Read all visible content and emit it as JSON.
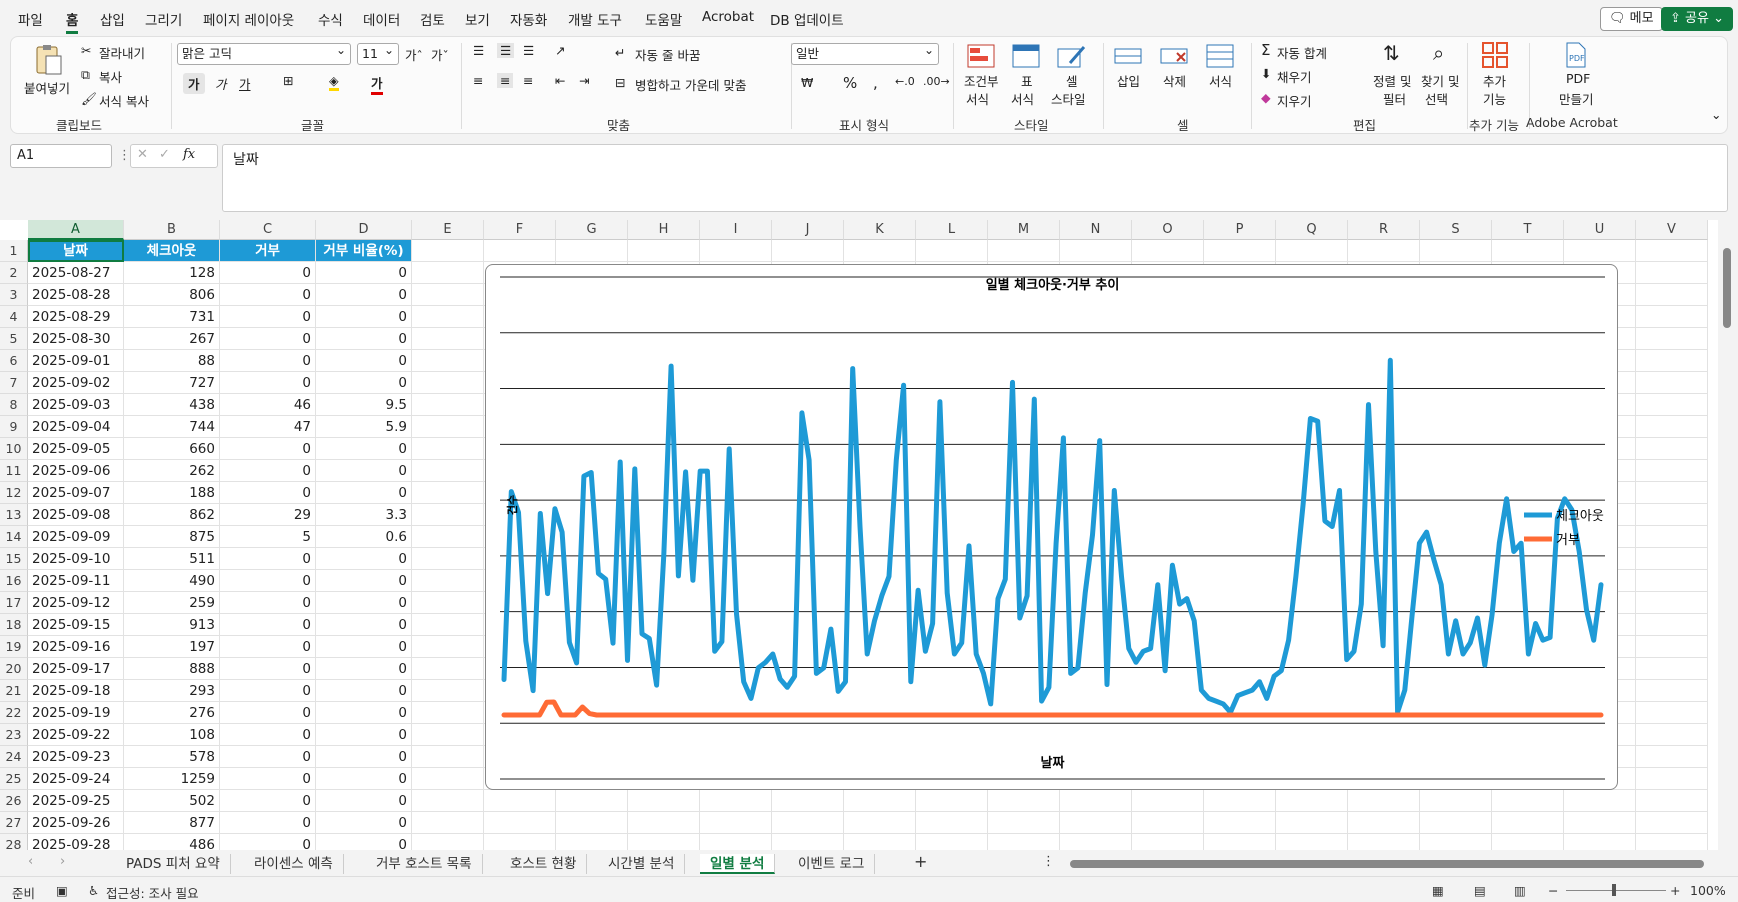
{
  "menubar": {
    "items": [
      "파일",
      "홈",
      "삽입",
      "그리기",
      "페이지 레이아웃",
      "수식",
      "데이터",
      "검토",
      "보기",
      "자동화",
      "개발 도구",
      "도움말",
      "Acrobat",
      "DB 업데이트"
    ],
    "active_index": 1,
    "memo_label": "메모",
    "share_label": "공유"
  },
  "ribbon": {
    "clipboard": {
      "paste": "붙여넣기",
      "cut": "잘라내기",
      "copy": "복사",
      "format_painter": "서식 복사",
      "label": "클립보드"
    },
    "font": {
      "name": "맑은 고딕",
      "size": "11",
      "bold": "가",
      "italic": "가",
      "underline": "가",
      "label": "글꼴"
    },
    "alignment": {
      "wrap": "자동 줄 바꿈",
      "merge": "병합하고 가운데 맞춤",
      "label": "맞춤"
    },
    "number": {
      "format": "일반",
      "label": "표시 형식"
    },
    "styles": {
      "conditional_1": "조건부",
      "conditional_2": "서식",
      "table_1": "표",
      "table_2": "서식",
      "cell_1": "셀",
      "cell_2": "스타일",
      "label": "스타일"
    },
    "cells": {
      "insert": "삽입",
      "delete": "삭제",
      "format": "서식",
      "label": "셀"
    },
    "editing": {
      "autosum": "자동 합계",
      "fill": "채우기",
      "clear": "지우기",
      "sort_1": "정렬 및",
      "sort_2": "필터",
      "find_1": "찾기 및",
      "find_2": "선택",
      "label": "편집"
    },
    "addins": {
      "btn_1": "추가",
      "btn_2": "기능",
      "label": "추가 기능"
    },
    "acrobat": {
      "btn_1": "PDF",
      "btn_2": "만들기",
      "label": "Adobe Acrobat"
    }
  },
  "formula": {
    "namebox": "A1",
    "fx": "fx",
    "content": "날짜"
  },
  "grid": {
    "columns": [
      "A",
      "B",
      "C",
      "D",
      "E",
      "F",
      "G",
      "H",
      "I",
      "J",
      "K",
      "L",
      "M",
      "N",
      "O",
      "P",
      "Q",
      "R",
      "S",
      "T",
      "U",
      "V"
    ],
    "headers": [
      "날짜",
      "체크아웃",
      "거부",
      "거부 비율(%)"
    ],
    "rows": [
      [
        "2025-08-27",
        "128",
        "0",
        "0"
      ],
      [
        "2025-08-28",
        "806",
        "0",
        "0"
      ],
      [
        "2025-08-29",
        "731",
        "0",
        "0"
      ],
      [
        "2025-08-30",
        "267",
        "0",
        "0"
      ],
      [
        "2025-09-01",
        "88",
        "0",
        "0"
      ],
      [
        "2025-09-02",
        "727",
        "0",
        "0"
      ],
      [
        "2025-09-03",
        "438",
        "46",
        "9.5"
      ],
      [
        "2025-09-04",
        "744",
        "47",
        "5.9"
      ],
      [
        "2025-09-05",
        "660",
        "0",
        "0"
      ],
      [
        "2025-09-06",
        "262",
        "0",
        "0"
      ],
      [
        "2025-09-07",
        "188",
        "0",
        "0"
      ],
      [
        "2025-09-08",
        "862",
        "29",
        "3.3"
      ],
      [
        "2025-09-09",
        "875",
        "5",
        "0.6"
      ],
      [
        "2025-09-10",
        "511",
        "0",
        "0"
      ],
      [
        "2025-09-11",
        "490",
        "0",
        "0"
      ],
      [
        "2025-09-12",
        "259",
        "0",
        "0"
      ],
      [
        "2025-09-15",
        "913",
        "0",
        "0"
      ],
      [
        "2025-09-16",
        "197",
        "0",
        "0"
      ],
      [
        "2025-09-17",
        "888",
        "0",
        "0"
      ],
      [
        "2025-09-18",
        "293",
        "0",
        "0"
      ],
      [
        "2025-09-19",
        "276",
        "0",
        "0"
      ],
      [
        "2025-09-22",
        "108",
        "0",
        "0"
      ],
      [
        "2025-09-23",
        "578",
        "0",
        "0"
      ],
      [
        "2025-09-24",
        "1259",
        "0",
        "0"
      ],
      [
        "2025-09-25",
        "502",
        "0",
        "0"
      ],
      [
        "2025-09-26",
        "877",
        "0",
        "0"
      ],
      [
        "2025-09-28",
        "486",
        "0",
        "0"
      ]
    ]
  },
  "chart_data": {
    "type": "line",
    "title": "일별 체크아웃·거부 추이",
    "xlabel": "날짜",
    "ylabel": "건수",
    "ylim": [
      0,
      1400
    ],
    "grid": true,
    "legend": "right",
    "series": [
      {
        "name": "체크아웃",
        "color": "#1e9ad6",
        "values": [
          128,
          806,
          731,
          267,
          88,
          727,
          438,
          744,
          660,
          262,
          188,
          862,
          875,
          511,
          490,
          259,
          913,
          197,
          888,
          293,
          276,
          108,
          578,
          1259,
          502,
          877,
          486,
          880,
          880,
          230,
          265,
          960,
          365,
          120,
          60,
          170,
          190,
          220,
          130,
          100,
          140,
          1090,
          920,
          150,
          170,
          310,
          85,
          120,
          1250,
          680,
          220,
          340,
          430,
          500,
          920,
          1190,
          120,
          450,
          230,
          330,
          1130,
          440,
          220,
          260,
          610,
          220,
          150,
          40,
          420,
          490,
          1200,
          350,
          430,
          1140,
          50,
          100,
          620,
          1000,
          150,
          170,
          440,
          650,
          990,
          110,
          810,
          500,
          240,
          190,
          230,
          240,
          470,
          160,
          540,
          400,
          420,
          340,
          90,
          60,
          50,
          40,
          10,
          70,
          80,
          90,
          120,
          60,
          140,
          160,
          270,
          500,
          760,
          1070,
          1060,
          700,
          680,
          810,
          200,
          230,
          400,
          1120,
          590,
          250,
          1280,
          10,
          90,
          360,
          620,
          660,
          560,
          470,
          220,
          340,
          220,
          260,
          350,
          180,
          360,
          620,
          780,
          590,
          620,
          220,
          330,
          270,
          280,
          710,
          780,
          740,
          590,
          380,
          270,
          470
        ]
      },
      {
        "name": "거부",
        "color": "#ff6b35",
        "values": [
          0,
          0,
          0,
          0,
          0,
          0,
          46,
          47,
          0,
          0,
          0,
          29,
          5,
          0,
          0,
          0,
          0,
          0,
          0,
          0,
          0,
          0,
          0,
          0,
          0,
          0,
          0,
          0,
          0,
          0,
          0,
          0,
          0,
          0,
          0,
          0,
          0,
          0,
          0,
          0,
          0,
          0,
          0,
          0,
          0,
          0,
          0,
          0,
          0,
          0,
          0,
          0,
          0,
          0,
          0,
          0,
          0,
          0,
          0,
          0,
          0,
          0,
          0,
          0,
          0,
          0,
          0,
          0,
          0,
          0,
          0,
          0,
          0,
          0,
          0,
          0,
          0,
          0,
          0,
          0,
          0,
          0,
          0,
          0,
          0,
          0,
          0,
          0,
          0,
          0,
          0,
          0,
          0,
          0,
          0,
          0,
          0,
          0,
          0,
          0,
          0,
          0,
          0,
          0,
          0,
          0,
          0,
          0,
          0,
          0,
          0,
          0,
          0,
          0,
          0,
          0,
          0,
          0,
          0,
          0,
          0,
          0,
          0,
          0,
          0,
          0,
          0,
          0,
          0,
          0,
          0,
          0,
          0,
          0,
          0,
          0,
          0,
          0,
          0,
          0,
          0,
          0,
          0,
          0,
          0,
          0,
          0,
          0,
          0,
          0,
          0,
          0,
          0,
          0,
          0
        ]
      }
    ]
  },
  "sheets": [
    "PADS 피처 요약",
    "라이센스 예측",
    "거부 호스트 목록",
    "호스트 현황",
    "시간별 분석",
    "일별 분석",
    "이벤트 로그"
  ],
  "active_sheet": 5,
  "status": {
    "ready": "준비",
    "accessibility": "접근성: 조사 필요",
    "zoom": "100%"
  }
}
